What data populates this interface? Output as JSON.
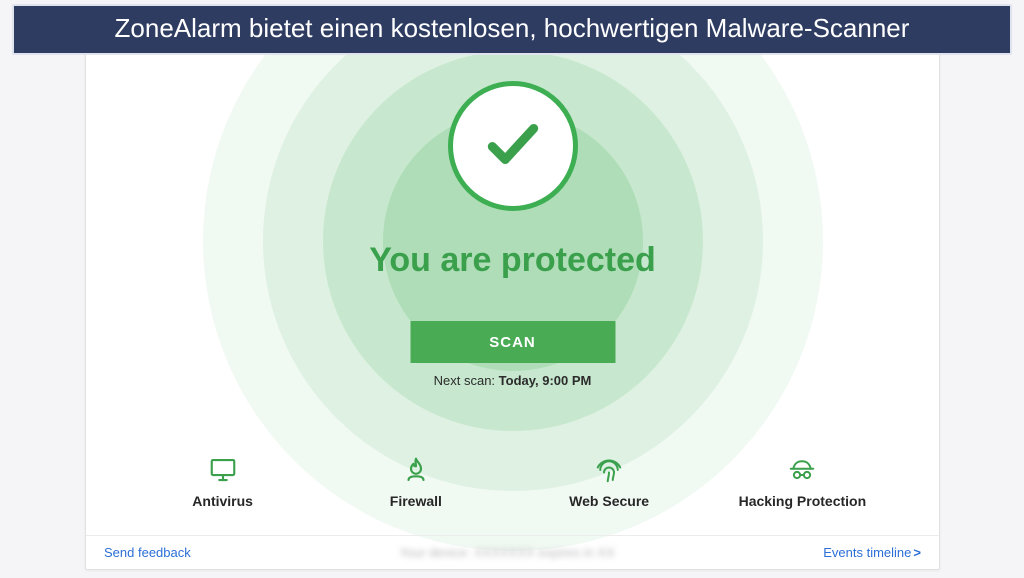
{
  "banner": {
    "text": "ZoneAlarm bietet einen kostenlosen, hochwertigen Malware-Scanner"
  },
  "status": {
    "headline": "You are protected",
    "scan_button": "SCAN",
    "next_scan_prefix": "Next scan: ",
    "next_scan_value": "Today, 9:00 PM"
  },
  "features": {
    "antivirus": "Antivirus",
    "firewall": "Firewall",
    "web_secure": "Web Secure",
    "hacking_protection": "Hacking Protection"
  },
  "footer": {
    "send_feedback": "Send feedback",
    "center_blurred": "Your device: XXXXXXX expires in XX",
    "events_timeline": "Events timeline",
    "chevron": ">"
  }
}
